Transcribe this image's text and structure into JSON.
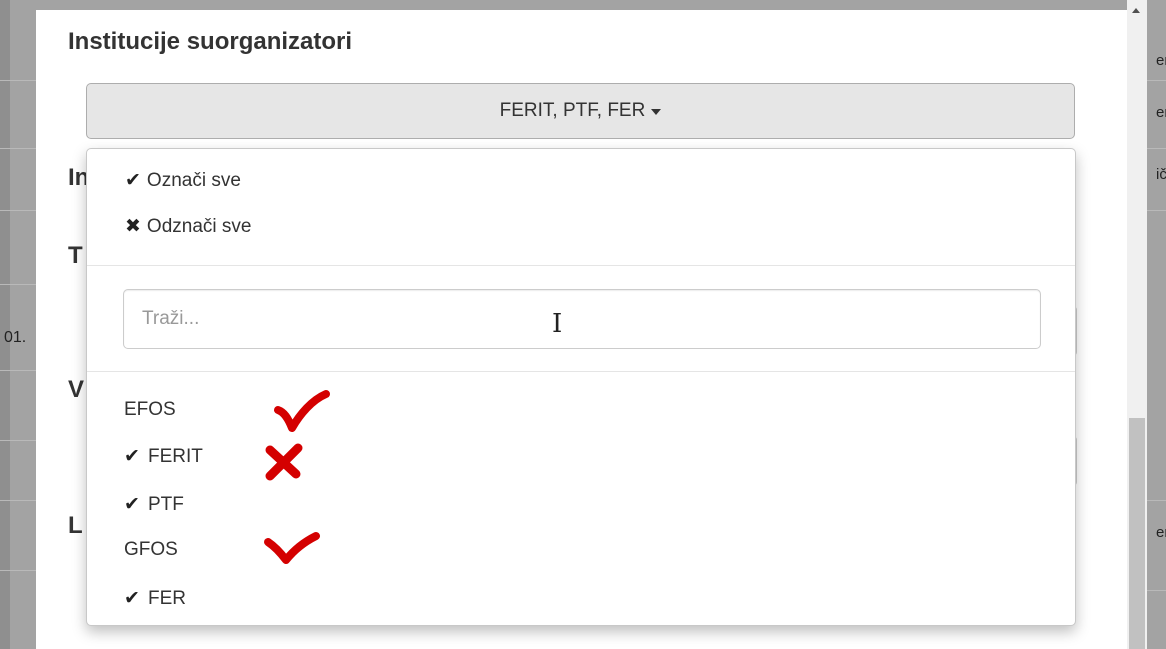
{
  "section": {
    "title": "Institucije suorganizatori"
  },
  "background_labels": [
    "In",
    "T",
    "V",
    "L"
  ],
  "background_date": "01.",
  "background_right": [
    "er",
    "er",
    "ič",
    "er"
  ],
  "dropdown": {
    "selected_text": "FERIT, PTF, FER",
    "select_all": "Označi sve",
    "deselect_all": "Odznači sve",
    "search_placeholder": "Traži...",
    "search_value": "",
    "options": [
      {
        "label": "EFOS",
        "checked": false,
        "annotation": "red-check"
      },
      {
        "label": "FERIT",
        "checked": true,
        "annotation": "red-cross"
      },
      {
        "label": "PTF",
        "checked": true,
        "annotation": ""
      },
      {
        "label": "GFOS",
        "checked": false,
        "annotation": "red-check"
      },
      {
        "label": "FER",
        "checked": true,
        "annotation": ""
      }
    ]
  },
  "icons": {
    "check": "check-icon",
    "cross": "cross-icon",
    "caret": "caret-down-icon"
  },
  "colors": {
    "annotation_red": "#d40000",
    "toggle_bg": "#e6e6e6",
    "overlay": "#9a9a9a"
  }
}
